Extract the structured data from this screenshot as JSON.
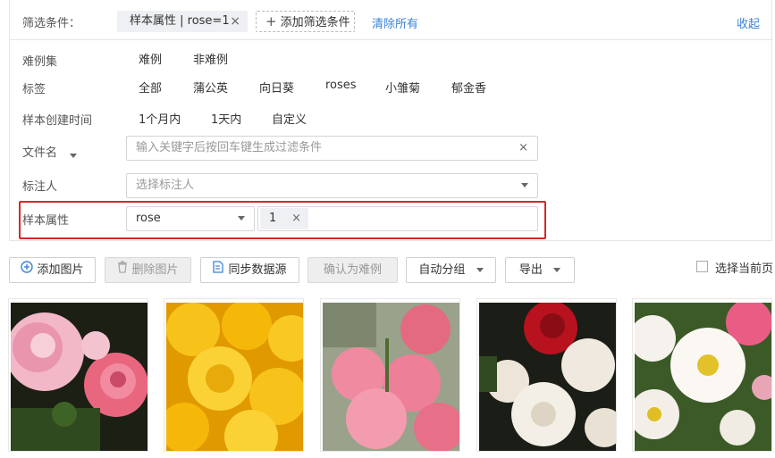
{
  "filter_header": {
    "label": "筛选条件：",
    "chip_text": "样本属性 | rose=1",
    "chip_close": "×",
    "add_filter_label": "添加筛选条件",
    "clear_all_label": "清除所有",
    "collapse_label": "收起"
  },
  "rows": {
    "hard_case": {
      "label": "难例集",
      "options": [
        "难例",
        "非难例"
      ]
    },
    "tags": {
      "label": "标签",
      "options": [
        "全部",
        "蒲公英",
        "向日葵",
        "roses",
        "小雏菊",
        "郁金香"
      ]
    },
    "created_time": {
      "label": "样本创建时间",
      "options": [
        "1个月内",
        "1天内",
        "自定义"
      ]
    },
    "filename": {
      "label": "文件名",
      "placeholder": "输入关键字后按回车键生成过滤条件",
      "clear": "×"
    },
    "labeler": {
      "label": "标注人",
      "placeholder": "选择标注人"
    },
    "sample_attr": {
      "label": "样本属性",
      "select_value": "rose",
      "tag_value": "1",
      "tag_close": "×"
    }
  },
  "toolbar": {
    "add_image": "添加图片",
    "delete_image": "删除图片",
    "sync_source": "同步数据源",
    "confirm_hard": "确认为难例",
    "auto_group": "自动分组",
    "export": "导出",
    "select_page": "选择当前页"
  },
  "colors": {
    "accent": "#3b82d8",
    "highlight": "#d9262a",
    "chip_bg": "#eef0f3"
  },
  "thumbnails": [
    {
      "name": "pink-roses-image"
    },
    {
      "name": "yellow-roses-image"
    },
    {
      "name": "pink-rose-bouquet-image"
    },
    {
      "name": "red-white-roses-image"
    },
    {
      "name": "wild-white-roses-image"
    }
  ]
}
